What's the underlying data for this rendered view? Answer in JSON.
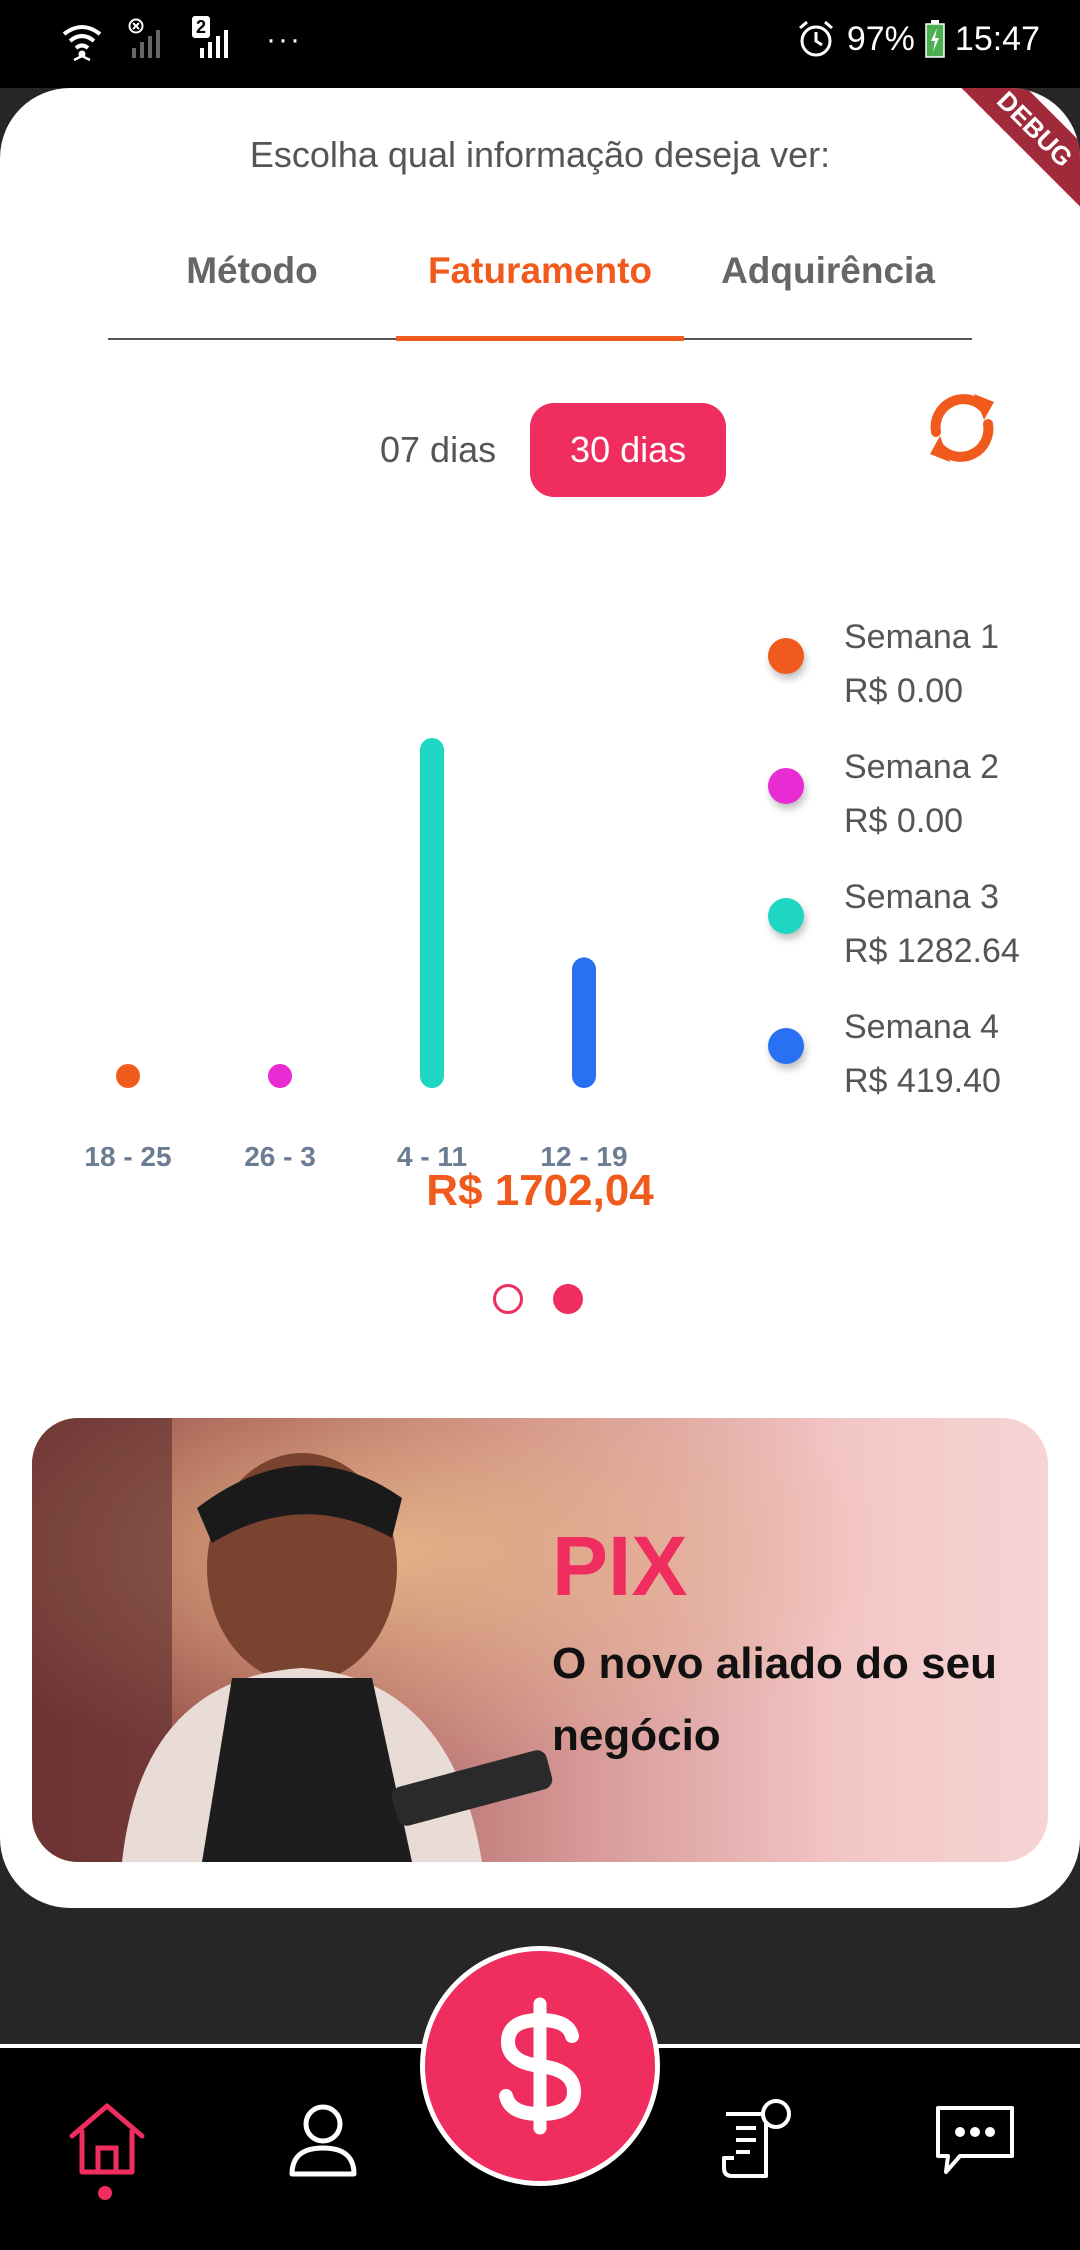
{
  "status_bar": {
    "battery": "97%",
    "time": "15:47",
    "sim_badge": "2",
    "more": "···"
  },
  "debug_banner": "DEBUG",
  "prompt": "Escolha qual informação deseja ver:",
  "tabs": [
    {
      "label": "Método",
      "active": false
    },
    {
      "label": "Faturamento",
      "active": true
    },
    {
      "label": "Adquirência",
      "active": false
    }
  ],
  "period": {
    "option_7": "07 dias",
    "option_30": "30 dias",
    "selected": "30 dias"
  },
  "chart_data": {
    "type": "bar",
    "categories": [
      "18 - 25",
      "26 - 3",
      "4 - 11",
      "12 - 19"
    ],
    "values": [
      0.0,
      0.0,
      1282.64,
      419.4
    ],
    "colors": [
      "#f05a1c",
      "#e92bd3",
      "#1ed6c3",
      "#2771f2"
    ],
    "ylim": [
      0,
      1282.64
    ]
  },
  "legend": [
    {
      "label": "Semana 1",
      "value": "R$ 0.00",
      "color": "#f05a1c"
    },
    {
      "label": "Semana 2",
      "value": "R$ 0.00",
      "color": "#e92bd3"
    },
    {
      "label": "Semana 3",
      "value": "R$ 1282.64",
      "color": "#1ed6c3"
    },
    {
      "label": "Semana 4",
      "value": "R$ 419.40",
      "color": "#2771f2"
    }
  ],
  "total": "R$ 1702,04",
  "pager": {
    "count": 2,
    "active_index": 1
  },
  "banner": {
    "title": "PIX",
    "tagline": "O novo aliado do seu negócio"
  },
  "colors": {
    "accent": "#f05a1c",
    "brand": "#ef2d5e"
  },
  "nav": [
    "home-icon",
    "profile-icon",
    "dollar-icon",
    "receipt-icon",
    "chat-icon"
  ]
}
